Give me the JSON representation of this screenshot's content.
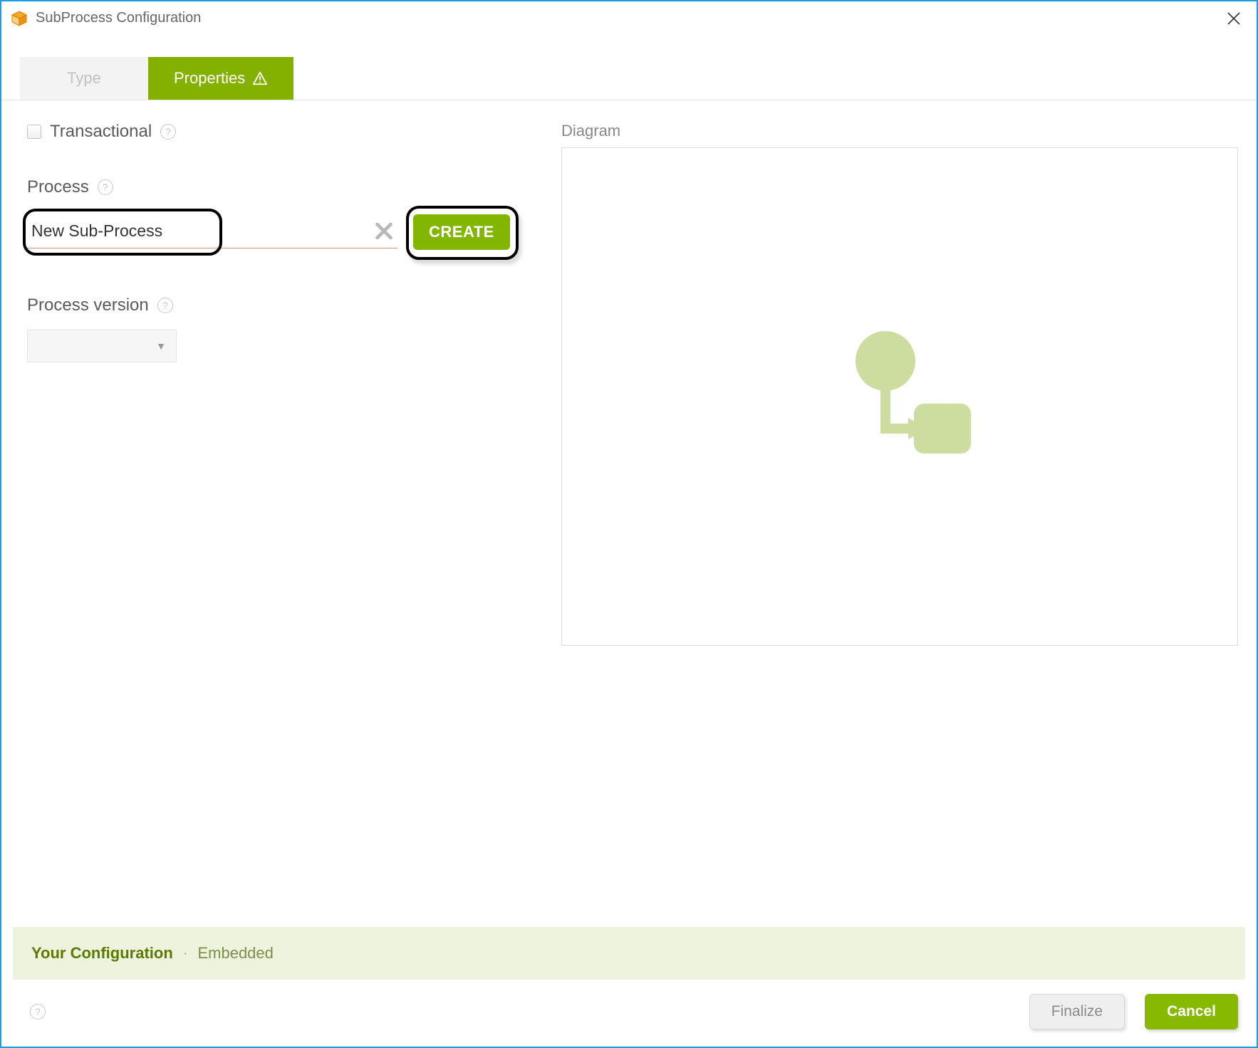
{
  "window": {
    "title": "SubProcess Configuration"
  },
  "tabs": {
    "type_label": "Type",
    "properties_label": "Properties"
  },
  "form": {
    "transactional_label": "Transactional",
    "process_label": "Process",
    "process_value": "New Sub-Process",
    "create_label": "CREATE",
    "process_version_label": "Process version"
  },
  "diagram": {
    "label": "Diagram"
  },
  "config_bar": {
    "title": "Your Configuration",
    "separator": "·",
    "value": "Embedded"
  },
  "footer": {
    "finalize_label": "Finalize",
    "cancel_label": "Cancel"
  },
  "colors": {
    "accent_green": "#84b100",
    "window_border": "#1e9de3",
    "diagram_shape": "#cddda0"
  }
}
